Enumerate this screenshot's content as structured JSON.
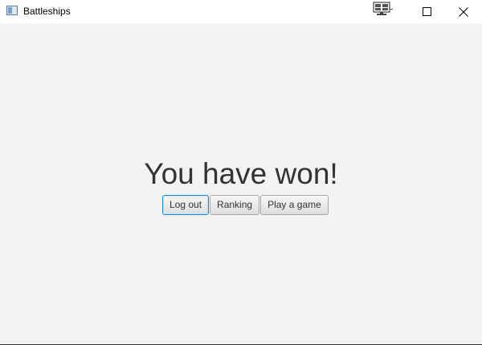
{
  "window": {
    "title": "Battleships"
  },
  "main": {
    "headline": "You have won!",
    "buttons": {
      "logout": "Log out",
      "ranking": "Ranking",
      "play": "Play a game"
    }
  },
  "icons": {
    "app": "window-app-icon",
    "tray": "monitor-icon",
    "maximize": "maximize-icon",
    "close": "close-icon"
  },
  "colors": {
    "focus_border": "#1f8ad8",
    "background": "#f3f3f3",
    "text": "#333333"
  }
}
